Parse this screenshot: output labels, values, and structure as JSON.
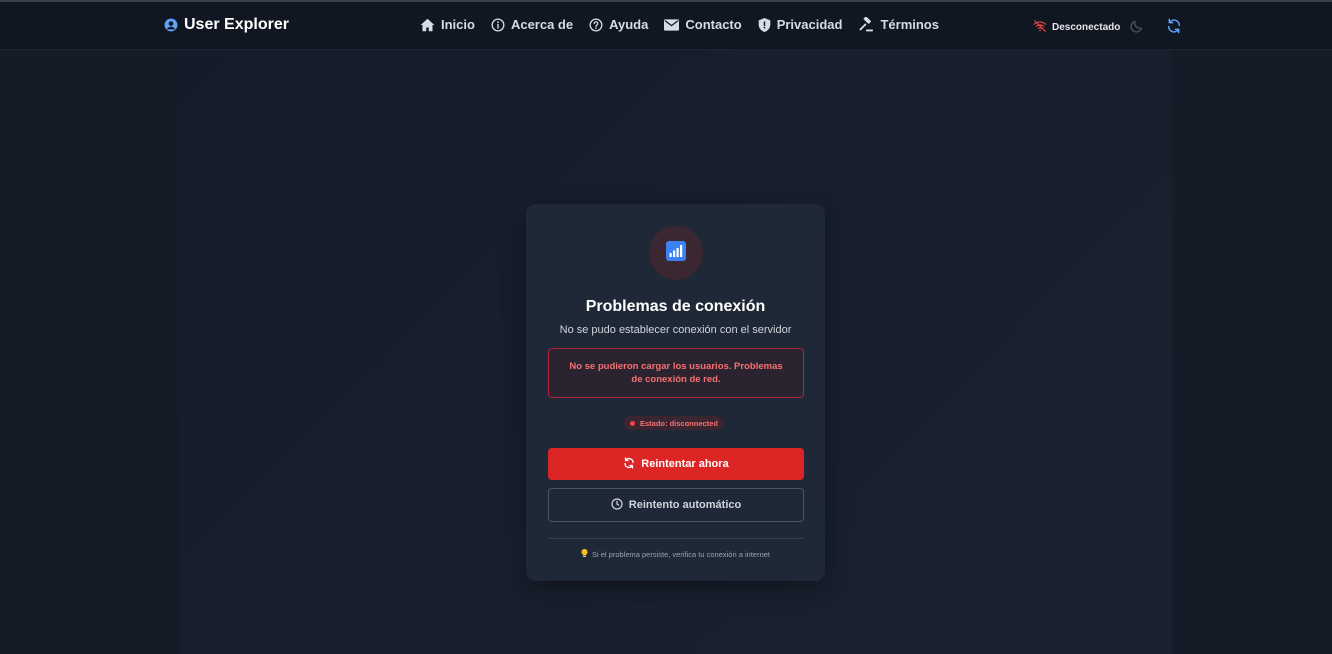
{
  "app": {
    "brand": "User Explorer"
  },
  "nav": {
    "links": [
      {
        "label": "Inicio",
        "icon": "home-icon"
      },
      {
        "label": "Acerca de",
        "icon": "info-icon"
      },
      {
        "label": "Ayuda",
        "icon": "help-icon"
      },
      {
        "label": "Contacto",
        "icon": "mail-icon"
      },
      {
        "label": "Privacidad",
        "icon": "shield-icon"
      },
      {
        "label": "Términos",
        "icon": "gavel-icon"
      }
    ]
  },
  "header": {
    "connection_status": "Desconectado",
    "connection_icon": "wifi-off-icon",
    "theme_icon": "moon-icon",
    "refresh_icon": "refresh-icon"
  },
  "card": {
    "icon": "signal-bars-icon",
    "title": "Problemas de conexión",
    "subtitle": "No se pudo establecer conexión con el servidor",
    "error_message": "No se pudieron cargar los usuarios. Problemas de conexión de red.",
    "status_label": "Estado: disconnected",
    "retry_button": "Reintentar ahora",
    "auto_retry_button": "Reintento automático",
    "hint_icon": "lightbulb-icon",
    "hint": "Si el problema persiste, verifica tu conexión a internet"
  },
  "colors": {
    "background": "#151b27",
    "navbar": "#111722",
    "card": "#1f2836",
    "accent_blue": "#60a5fa",
    "danger": "#dc2626",
    "error_text": "#f87171"
  }
}
